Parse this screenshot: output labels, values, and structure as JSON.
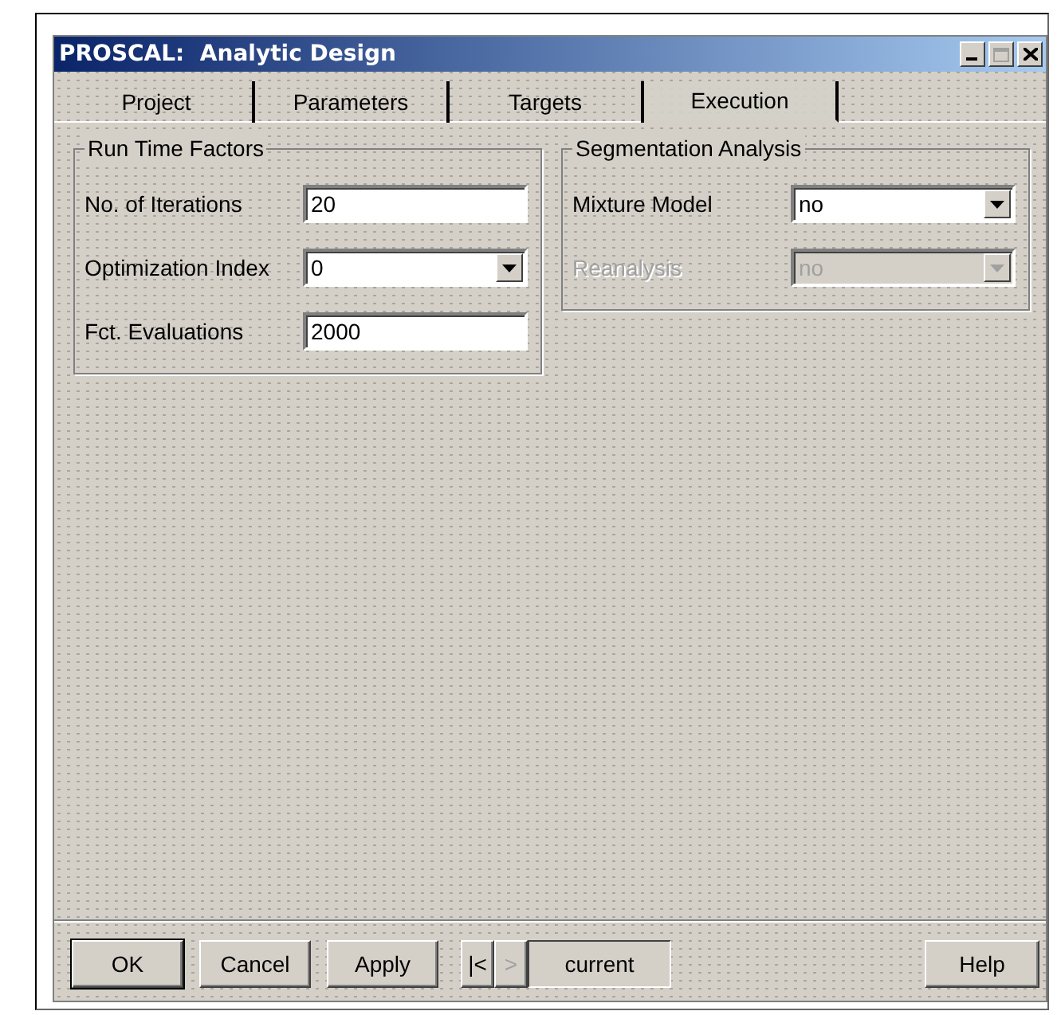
{
  "window": {
    "title": "PROSCAL:  Analytic Design"
  },
  "tabs": [
    {
      "label": "Project",
      "selected": false
    },
    {
      "label": "Parameters",
      "selected": false
    },
    {
      "label": "Targets",
      "selected": false
    },
    {
      "label": "Execution",
      "selected": true
    }
  ],
  "groups": [
    {
      "title": "Run Time Factors",
      "fields": [
        {
          "kind": "text",
          "label": "No. of Iterations",
          "value": "20",
          "disabled": false
        },
        {
          "kind": "dropdown",
          "label": "Optimization Index",
          "value": "0",
          "disabled": false
        },
        {
          "kind": "text",
          "label": "Fct. Evaluations",
          "value": "2000",
          "disabled": false
        }
      ]
    },
    {
      "title": "Segmentation Analysis",
      "fields": [
        {
          "kind": "dropdown",
          "label": "Mixture Model",
          "value": "no",
          "disabled": false
        },
        {
          "kind": "dropdown",
          "label": "Reanalysis",
          "value": "no",
          "disabled": true
        }
      ]
    }
  ],
  "footer": {
    "buttons": [
      {
        "label": "OK",
        "default": true
      },
      {
        "label": "Cancel",
        "default": false
      },
      {
        "label": "Apply",
        "default": false
      }
    ],
    "nav_buttons": [
      {
        "label": "|<",
        "disabled": false
      },
      {
        "label": ">",
        "disabled": true
      }
    ],
    "record": "current",
    "help": "Help"
  }
}
